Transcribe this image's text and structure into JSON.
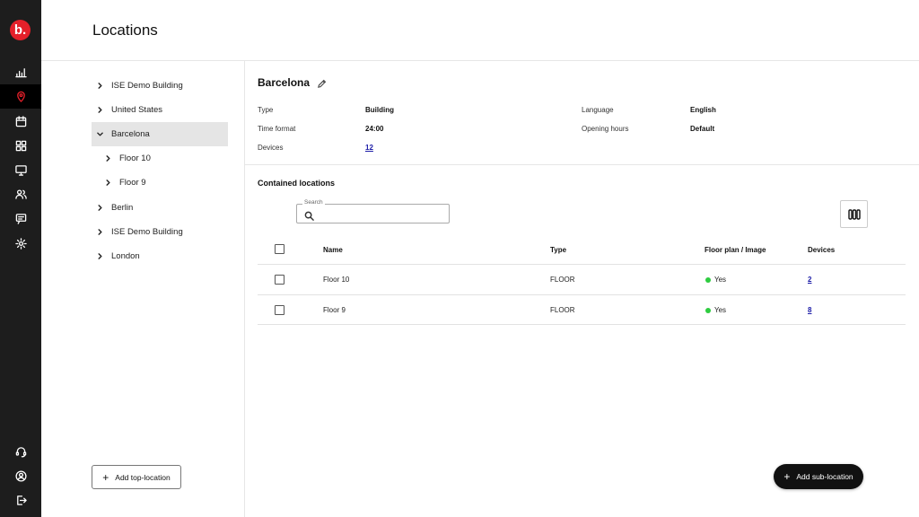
{
  "brand": {
    "logo_text": "b.",
    "accent": "#e4202a"
  },
  "rail": [
    {
      "icon": "analytics-icon"
    },
    {
      "icon": "location-pin-icon",
      "active": true
    },
    {
      "icon": "calendar-icon"
    },
    {
      "icon": "grid-icon"
    },
    {
      "icon": "monitor-icon"
    },
    {
      "icon": "users-icon"
    },
    {
      "icon": "message-icon"
    },
    {
      "icon": "settings-icon"
    },
    {
      "icon": "support-icon"
    },
    {
      "icon": "account-icon"
    },
    {
      "icon": "logout-icon"
    }
  ],
  "header": {
    "title": "Locations"
  },
  "tree": {
    "items": [
      {
        "label": "ISE Demo Building",
        "level": 0,
        "expanded": false
      },
      {
        "label": "United States",
        "level": 0,
        "expanded": false
      },
      {
        "label": "Barcelona",
        "level": 0,
        "expanded": true,
        "selected": true
      },
      {
        "label": "Floor 10",
        "level": 1,
        "expanded": false
      },
      {
        "label": "Floor 9",
        "level": 1,
        "expanded": false
      },
      {
        "label": "Berlin",
        "level": 0,
        "expanded": false
      },
      {
        "label": "ISE Demo Building",
        "level": 0,
        "expanded": false
      },
      {
        "label": "London",
        "level": 0,
        "expanded": false
      }
    ],
    "add_button": "Add top-location"
  },
  "detail": {
    "name": "Barcelona",
    "type_label": "Type",
    "type_value": "Building",
    "time_format_label": "Time format",
    "time_format_value": "24:00",
    "devices_label": "Devices",
    "devices_value": "12",
    "language_label": "Language",
    "language_value": "English",
    "opening_hours_label": "Opening hours",
    "opening_hours_value": "Default"
  },
  "contained": {
    "title": "Contained locations",
    "search_label": "Search",
    "search_value": "",
    "columns": [
      "Name",
      "Type",
      "Floor plan / Image",
      "Devices"
    ],
    "rows": [
      {
        "name": "Floor 10",
        "type": "FLOOR",
        "floor_plan": "Yes",
        "devices": "2"
      },
      {
        "name": "Floor 9",
        "type": "FLOOR",
        "floor_plan": "Yes",
        "devices": "8"
      }
    ],
    "status_color": "#2ecc40"
  },
  "add_sub_button": "Add sub-location"
}
